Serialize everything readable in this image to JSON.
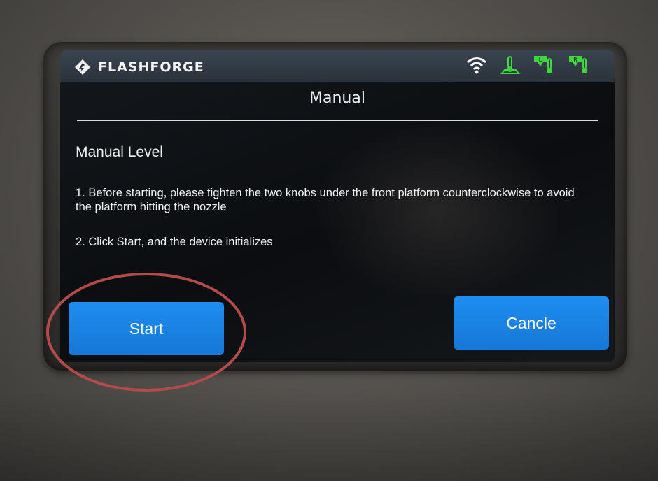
{
  "statusbar": {
    "brand": "FLASHFORGE",
    "icons": [
      "flashforge-logo-icon",
      "wifi-icon",
      "platform-temperature-icon",
      "left-extruder-temperature-icon",
      "right-extruder-temperature-icon"
    ],
    "icon_badges": {
      "left": "L",
      "right": "R"
    },
    "colors": {
      "icon_green": "#3fd640",
      "wifi": "#ffffff"
    }
  },
  "page": {
    "title": "Manual",
    "heading": "Manual Level",
    "steps": [
      "1. Before starting, please tighten the two knobs under the front platform counterclockwise to avoid the platform hitting the nozzle",
      "2. Click Start, and the device initializes"
    ]
  },
  "buttons": {
    "start_label": "Start",
    "cancel_label": "Cancle"
  },
  "colors": {
    "button_blue": "#1a84e6",
    "screen_bg": "#0f1215",
    "annotation_red": "#b54a4a"
  }
}
